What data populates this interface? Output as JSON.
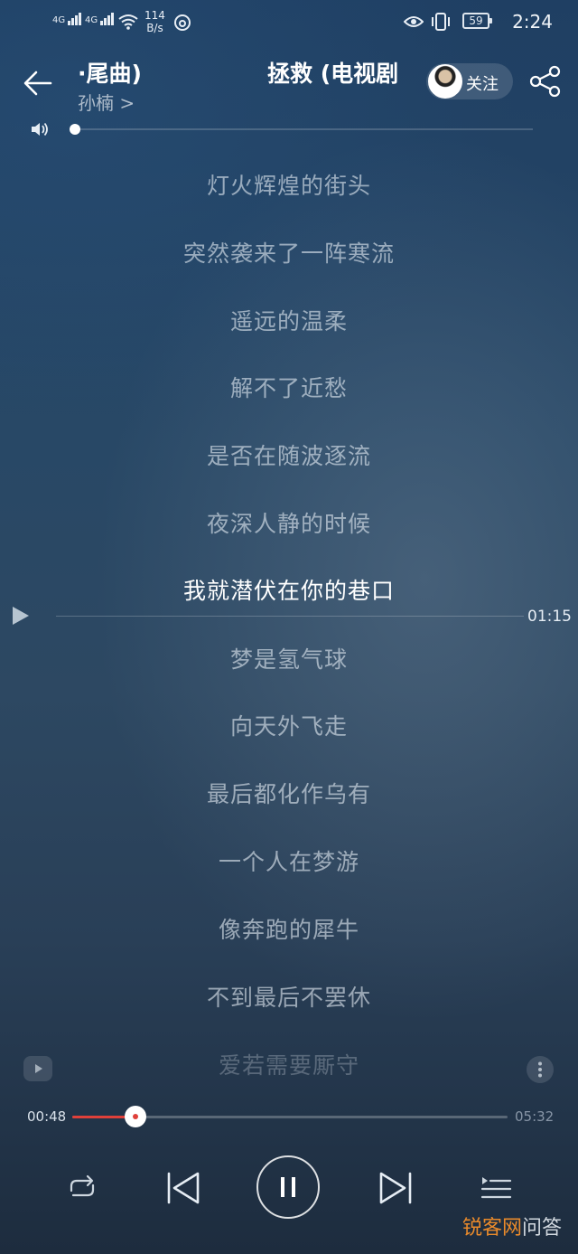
{
  "status_bar": {
    "sig1": "4G",
    "sig2": "4G",
    "speed_value": "114",
    "speed_unit": "B/s",
    "battery": "59",
    "time": "2:24"
  },
  "header": {
    "title_left": "·尾曲)",
    "title_right": "拯救 (电视剧",
    "artist": "孙楠 >",
    "follow_label": "关注"
  },
  "lyrics": [
    {
      "text": "灯火辉煌的街头"
    },
    {
      "text": "突然袭来了一阵寒流"
    },
    {
      "text": "遥远的温柔"
    },
    {
      "text": "解不了近愁"
    },
    {
      "text": "是否在随波逐流"
    },
    {
      "text": "夜深人静的时候"
    },
    {
      "text": "我就潜伏在你的巷口"
    },
    {
      "text": "梦是氢气球"
    },
    {
      "text": "向天外飞走"
    },
    {
      "text": "最后都化作乌有"
    },
    {
      "text": "一个人在梦游"
    },
    {
      "text": "像奔跑的犀牛"
    },
    {
      "text": "不到最后不罢休"
    },
    {
      "text": "爱若需要厮守"
    }
  ],
  "active_lyric_index": 6,
  "seek_time": "01:15",
  "progress": {
    "current": "00:48",
    "total": "05:32",
    "fraction": 0.1446
  },
  "volume": {
    "fraction": 0.0
  },
  "colors": {
    "accent": "#e0403a",
    "watermark_orange": "#e98a2b"
  },
  "icons": {
    "back": "arrow-left",
    "share": "share-nodes",
    "volume": "speaker",
    "repeat": "repeat",
    "prev": "skip-previous",
    "pause": "pause",
    "next": "skip-next",
    "playlist": "playlist"
  },
  "watermark": {
    "part1": "锐客",
    "part2": "网",
    "part3": "问答"
  }
}
